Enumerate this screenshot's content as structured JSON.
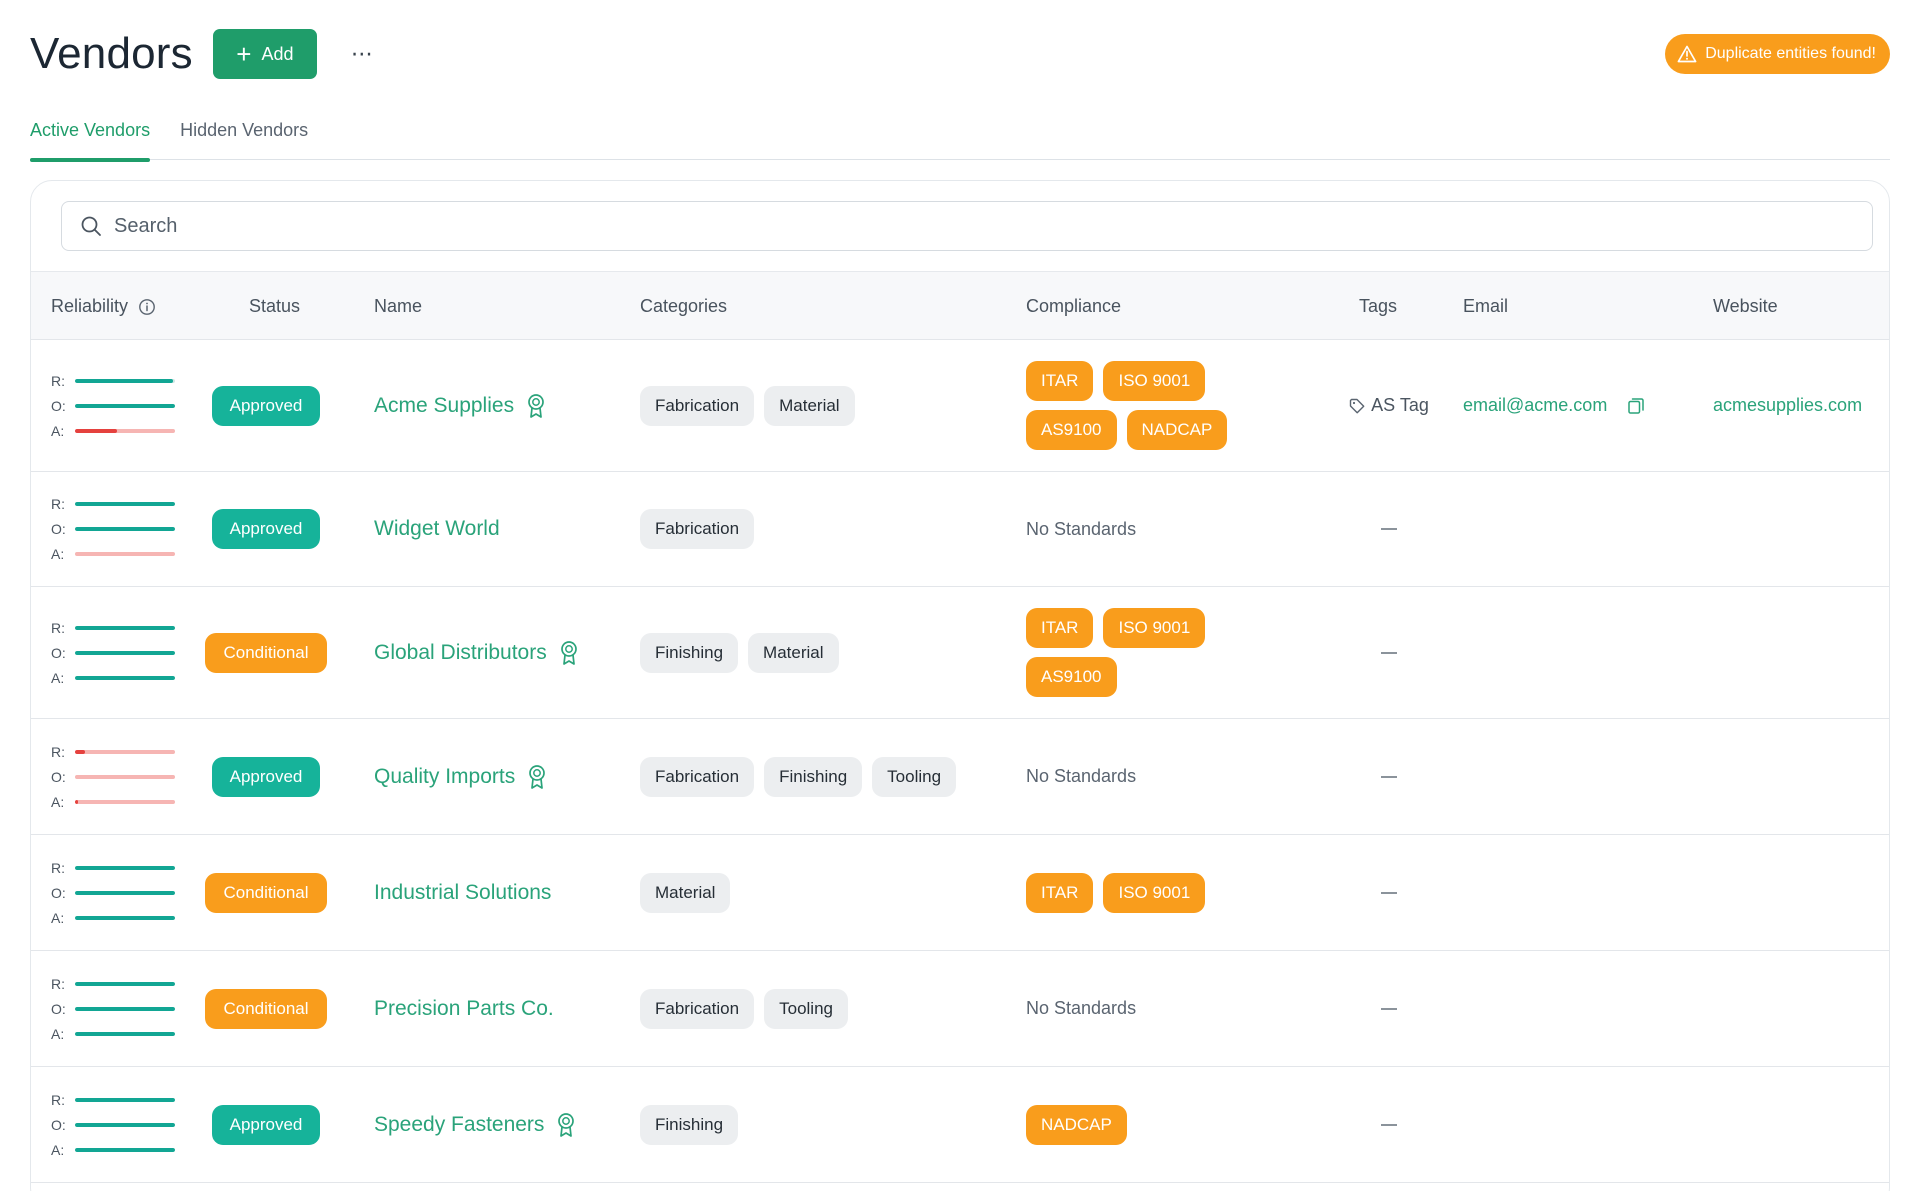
{
  "header": {
    "title": "Vendors",
    "add_label": "Add",
    "more_label": "⋯",
    "duplicate_warning": "Duplicate entities found!"
  },
  "tabs": [
    {
      "label": "Active Vendors",
      "active": true
    },
    {
      "label": "Hidden Vendors",
      "active": false
    }
  ],
  "search": {
    "placeholder": "Search",
    "value": ""
  },
  "table": {
    "headers": {
      "reliability": "Reliability",
      "status": "Status",
      "name": "Name",
      "categories": "Categories",
      "compliance": "Compliance",
      "tags": "Tags",
      "email": "Email",
      "website": "Website"
    },
    "reliability_keys": [
      "R:",
      "O:",
      "A:"
    ],
    "no_standards_label": "No Standards",
    "rows": [
      {
        "reliability": [
          0.98,
          1.0,
          0.42
        ],
        "status": "Approved",
        "name": "Acme Supplies",
        "certified": true,
        "categories": [
          "Fabrication",
          "Material"
        ],
        "compliance": [
          "ITAR",
          "ISO 9001",
          "AS9100",
          "NADCAP"
        ],
        "tags": [
          "AS Tag"
        ],
        "email": "email@acme.com",
        "website": "acmesupplies.com"
      },
      {
        "reliability": [
          1.0,
          1.0,
          0.0
        ],
        "status": "Approved",
        "name": "Widget World",
        "certified": false,
        "categories": [
          "Fabrication"
        ],
        "compliance": [],
        "tags": [],
        "email": "",
        "website": ""
      },
      {
        "reliability": [
          1.0,
          1.0,
          1.0
        ],
        "status": "Conditional",
        "name": "Global Distributors",
        "certified": true,
        "categories": [
          "Finishing",
          "Material"
        ],
        "compliance": [
          "ITAR",
          "ISO 9001",
          "AS9100"
        ],
        "tags": [],
        "email": "",
        "website": ""
      },
      {
        "reliability": [
          0.1,
          0.0,
          0.03
        ],
        "status": "Approved",
        "name": "Quality Imports",
        "certified": true,
        "categories": [
          "Fabrication",
          "Finishing",
          "Tooling"
        ],
        "compliance": [],
        "tags": [],
        "email": "",
        "website": ""
      },
      {
        "reliability": [
          1.0,
          1.0,
          1.0
        ],
        "status": "Conditional",
        "name": "Industrial Solutions",
        "certified": false,
        "categories": [
          "Material"
        ],
        "compliance": [
          "ITAR",
          "ISO 9001"
        ],
        "tags": [],
        "email": "",
        "website": ""
      },
      {
        "reliability": [
          1.0,
          1.0,
          1.0
        ],
        "status": "Conditional",
        "name": "Precision Parts Co.",
        "certified": false,
        "categories": [
          "Fabrication",
          "Tooling"
        ],
        "compliance": [],
        "tags": [],
        "email": "",
        "website": ""
      },
      {
        "reliability": [
          1.0,
          1.0,
          1.0
        ],
        "status": "Approved",
        "name": "Speedy Fasteners",
        "certified": true,
        "categories": [
          "Finishing"
        ],
        "compliance": [
          "NADCAP"
        ],
        "tags": [],
        "email": "",
        "website": ""
      }
    ]
  },
  "colors": {
    "brand_green": "#1f9d6a",
    "link_green": "#2aa37a",
    "approved_teal": "#16b39a",
    "conditional_orange": "#f99d1c",
    "reliability_good": "#12a694",
    "reliability_bad": "#e5413e",
    "reliability_track_bad": "#f6b5b3"
  }
}
